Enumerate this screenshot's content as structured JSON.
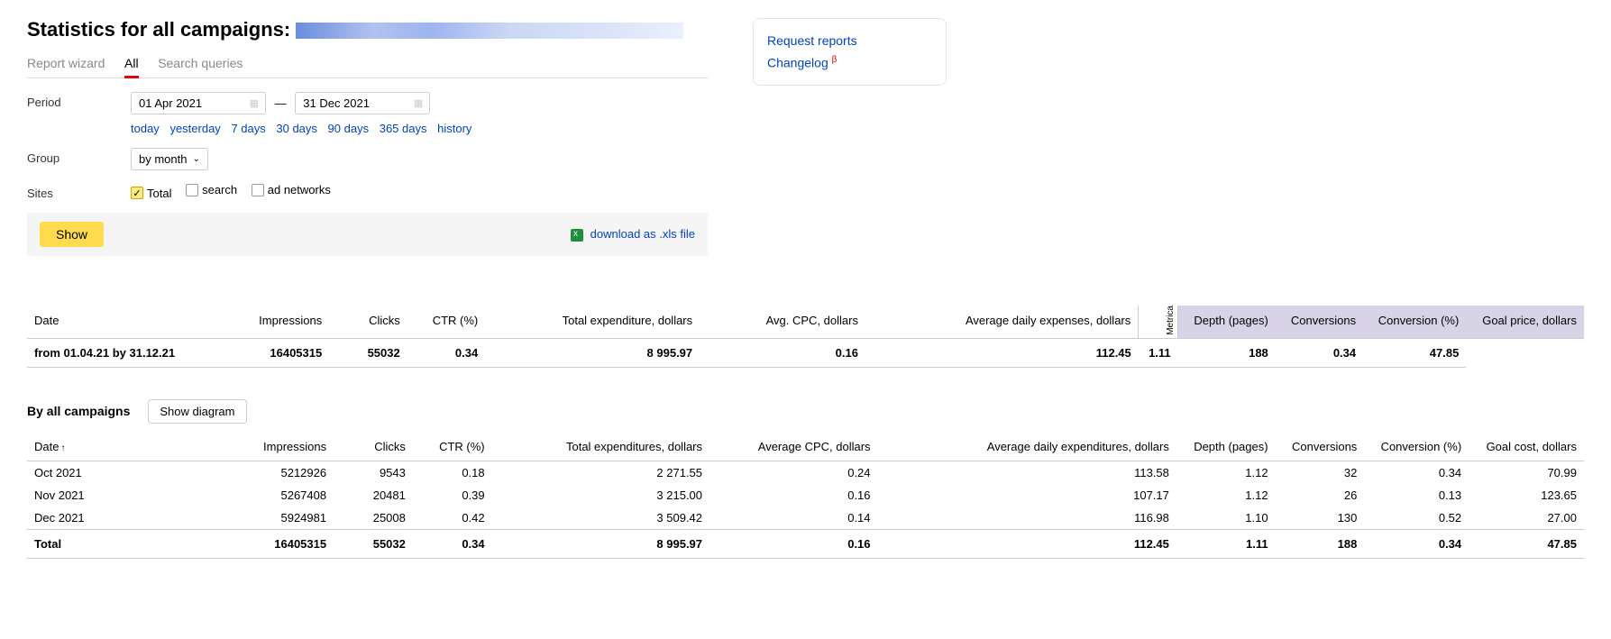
{
  "header": {
    "title": "Statistics for all campaigns:"
  },
  "side": {
    "request_reports": "Request reports",
    "changelog": "Changelog",
    "beta": "β"
  },
  "tabs": {
    "report_wizard": "Report wizard",
    "all": "All",
    "search_queries": "Search queries"
  },
  "filters": {
    "period_label": "Period",
    "date_from": "01 Apr 2021",
    "date_to": "31 Dec 2021",
    "quick": {
      "today": "today",
      "yesterday": "yesterday",
      "d7": "7 days",
      "d30": "30 days",
      "d90": "90 days",
      "d365": "365 days",
      "history": "history"
    },
    "group_label": "Group",
    "group_value": "by month",
    "sites_label": "Sites",
    "sites": {
      "total": "Total",
      "search": "search",
      "ad_networks": "ad networks"
    }
  },
  "actions": {
    "show": "Show",
    "download": "download as .xls file"
  },
  "summary_table": {
    "cols": {
      "date": "Date",
      "impressions": "Impressions",
      "clicks": "Clicks",
      "ctr": "CTR (%)",
      "total_exp": "Total expenditure, dollars",
      "avg_cpc": "Avg. CPC, dollars",
      "avg_daily": "Average daily expenses, dollars",
      "metrica": "Metrica",
      "depth": "Depth (pages)",
      "conversions": "Conversions",
      "conv_pct": "Conversion (%)",
      "goal_price": "Goal price, dollars"
    },
    "row": {
      "date": "from 01.04.21 by 31.12.21",
      "impressions": "16405315",
      "clicks": "55032",
      "ctr": "0.34",
      "total_exp": "8 995.97",
      "avg_cpc": "0.16",
      "avg_daily": "112.45",
      "depth": "1.11",
      "conversions": "188",
      "conv_pct": "0.34",
      "goal_price": "47.85"
    }
  },
  "detail": {
    "title": "By all campaigns",
    "show_diagram": "Show diagram",
    "cols": {
      "date": "Date",
      "impressions": "Impressions",
      "clicks": "Clicks",
      "ctr": "CTR (%)",
      "total_exp": "Total expenditures, dollars",
      "avg_cpc": "Average CPC, dollars",
      "avg_daily": "Average daily expenditures, dollars",
      "depth": "Depth (pages)",
      "conversions": "Conversions",
      "conv_pct": "Conversion (%)",
      "goal_cost": "Goal cost, dollars"
    },
    "rows": [
      {
        "date": "Oct 2021",
        "impressions": "5212926",
        "clicks": "9543",
        "ctr": "0.18",
        "total_exp": "2 271.55",
        "avg_cpc": "0.24",
        "avg_daily": "113.58",
        "depth": "1.12",
        "conversions": "32",
        "conv_pct": "0.34",
        "goal_cost": "70.99"
      },
      {
        "date": "Nov 2021",
        "impressions": "5267408",
        "clicks": "20481",
        "ctr": "0.39",
        "total_exp": "3 215.00",
        "avg_cpc": "0.16",
        "avg_daily": "107.17",
        "depth": "1.12",
        "conversions": "26",
        "conv_pct": "0.13",
        "goal_cost": "123.65"
      },
      {
        "date": "Dec 2021",
        "impressions": "5924981",
        "clicks": "25008",
        "ctr": "0.42",
        "total_exp": "3 509.42",
        "avg_cpc": "0.14",
        "avg_daily": "116.98",
        "depth": "1.10",
        "conversions": "130",
        "conv_pct": "0.52",
        "goal_cost": "27.00"
      }
    ],
    "total": {
      "label": "Total",
      "impressions": "16405315",
      "clicks": "55032",
      "ctr": "0.34",
      "total_exp": "8 995.97",
      "avg_cpc": "0.16",
      "avg_daily": "112.45",
      "depth": "1.11",
      "conversions": "188",
      "conv_pct": "0.34",
      "goal_cost": "47.85"
    }
  }
}
